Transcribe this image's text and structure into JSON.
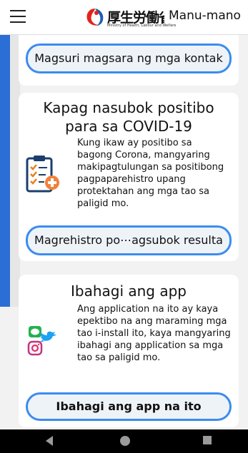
{
  "header": {
    "logo_kanji": "厚生労働省",
    "logo_subtitle": "Ministry of Health, Labour and Welfare",
    "language": "Manu-mano"
  },
  "card_contacts": {
    "button_label": "Magsuri magsara ng mga kontak"
  },
  "card_positive": {
    "title_line1": "Kapag nasubok positibo",
    "title_line2": "para sa COVID-19",
    "body": "Kung ikaw ay positibo sa bagong Corona, mangyaring makipagtulungan sa positibong pagpaparehistro upang protektahan ang mga tao sa paligid mo.",
    "button_label": "Magrehistro po⋯agsubok resulta"
  },
  "card_share": {
    "title": "Ibahagi ang app",
    "body": "Ang application na ito ay kaya epektibo na ang maraming mga tao i-install ito, kaya mangyaring ibahagi ang application sa mga tao sa paligid mo.",
    "button_label": "Ibahagi ang app na ito"
  },
  "icons": [
    "menu-icon",
    "mhlw-logo-icon",
    "clipboard-plus-icon",
    "line-icon",
    "twitter-icon",
    "instagram-icon",
    "back-icon",
    "home-icon",
    "recents-icon"
  ],
  "colors": {
    "accent": "#3b8cef",
    "stripe": "#2a6ed6",
    "navbar": "#000000"
  }
}
